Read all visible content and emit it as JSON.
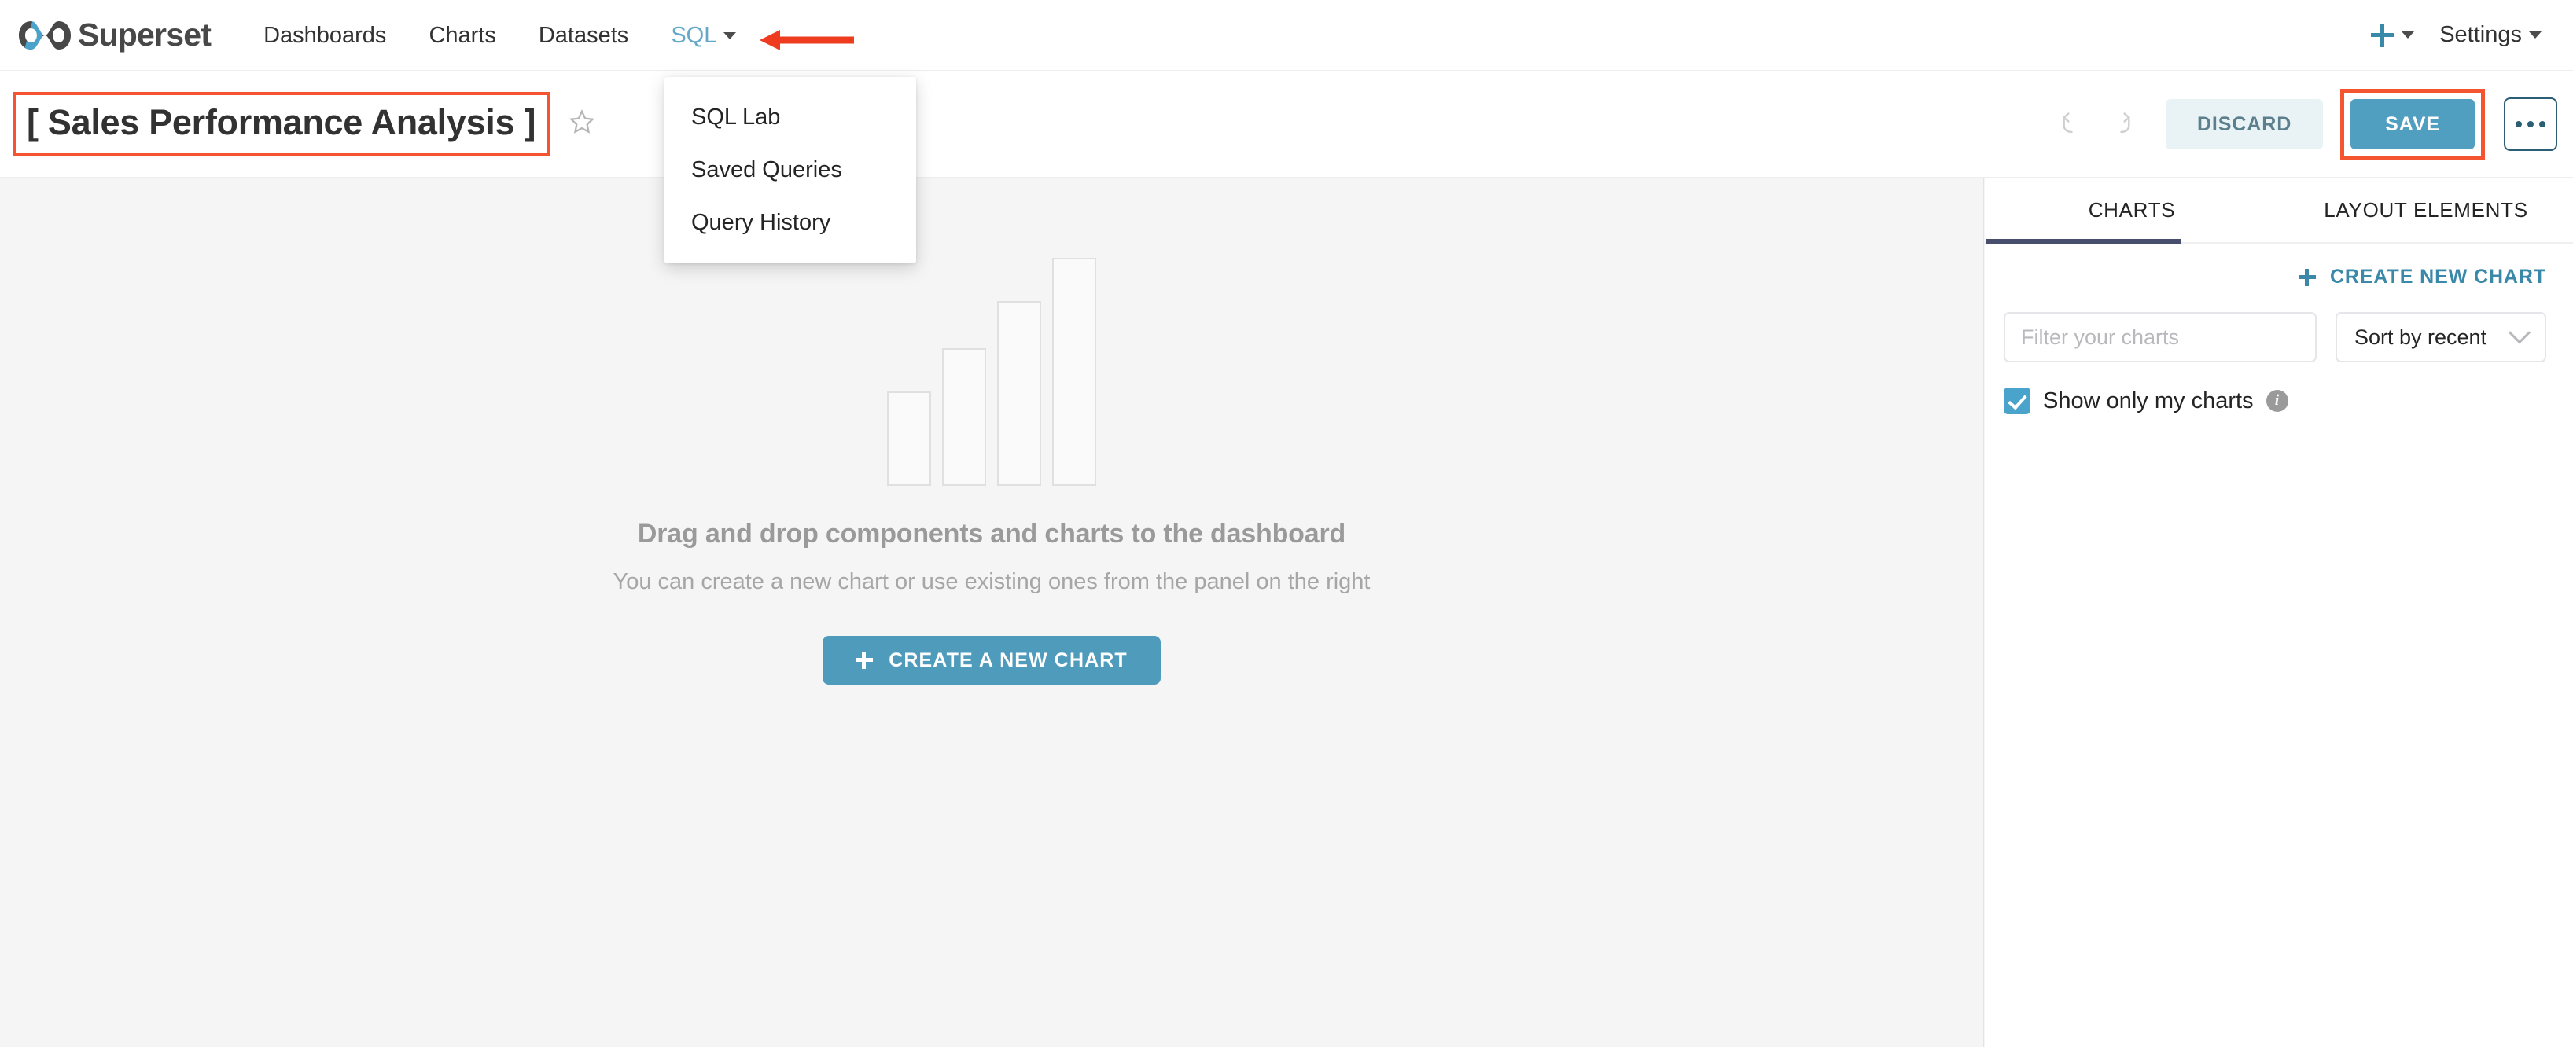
{
  "navbar": {
    "brand": "Superset",
    "brand_logo_icon": "superset-infinity-logo",
    "links": [
      {
        "label": "Dashboards",
        "active": false
      },
      {
        "label": "Charts",
        "active": false
      },
      {
        "label": "Datasets",
        "active": false
      },
      {
        "label": "SQL",
        "active": true,
        "has_caret": true
      }
    ],
    "plus_icon": "plus-icon",
    "settings_label": "Settings"
  },
  "annotation": {
    "arrow_icon": "red-left-arrow",
    "arrow_color": "#ef3b20",
    "highlight_color": "#f4542f"
  },
  "sql_dropdown": {
    "items": [
      {
        "label": "SQL Lab"
      },
      {
        "label": "Saved Queries"
      },
      {
        "label": "Query History"
      }
    ]
  },
  "dashboard_header": {
    "title": "[ Sales Performance Analysis ]",
    "star_icon": "star-outline-icon",
    "undo_icon": "undo-arrow-icon",
    "redo_icon": "redo-arrow-icon",
    "discard_label": "DISCARD",
    "save_label": "SAVE",
    "more_icon": "ellipsis-icon",
    "save_button_color": "#519fc0",
    "discard_button_color": "#e9f2f4"
  },
  "empty_state": {
    "title": "Drag and drop components and charts to the dashboard",
    "subtitle": "You can create a new chart or use existing ones from the panel on the right",
    "create_chart_label": "CREATE A NEW CHART",
    "create_chart_icon": "plus-icon",
    "placeholder_chart_icon": "bar-chart-outline-icon",
    "bar_heights": [
      120,
      175,
      235,
      290
    ]
  },
  "right_panel": {
    "tabs": [
      {
        "label": "CHARTS",
        "active": true
      },
      {
        "label": "LAYOUT ELEMENTS",
        "active": false
      }
    ],
    "active_tab_color": "#484f6e",
    "create_new_chart_label": "CREATE NEW CHART",
    "create_new_chart_icon": "plus-icon",
    "filter": {
      "value": "",
      "placeholder": "Filter your charts"
    },
    "sort": {
      "value": "Sort by recent",
      "chevron_icon": "chevron-down-icon"
    },
    "show_only_my_charts": {
      "label": "Show only my charts",
      "checked": true,
      "info_icon": "info-circle-icon"
    }
  }
}
